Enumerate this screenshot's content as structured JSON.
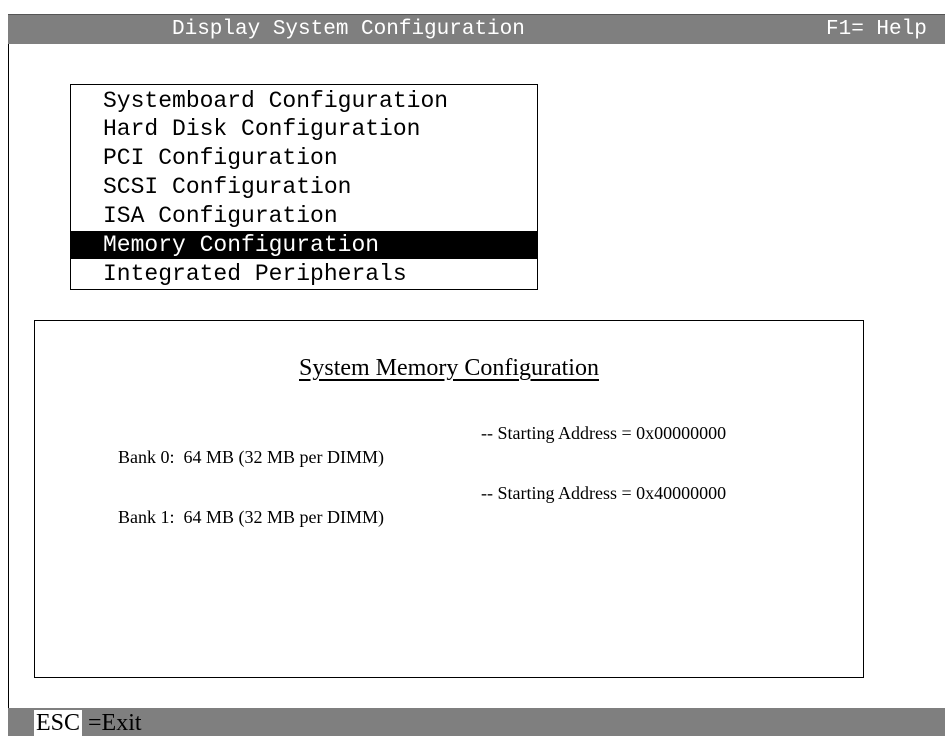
{
  "window": {
    "title": "Display System Configuration",
    "help": "F1= Help"
  },
  "menu": {
    "items": [
      {
        "label": "Systemboard Configuration",
        "selected": false
      },
      {
        "label": "Hard Disk Configuration",
        "selected": false
      },
      {
        "label": "PCI Configuration",
        "selected": false
      },
      {
        "label": "SCSI Configuration",
        "selected": false
      },
      {
        "label": "ISA Configuration",
        "selected": false
      },
      {
        "label": "Memory Configuration",
        "selected": true
      },
      {
        "label": "Integrated Peripherals",
        "selected": false
      }
    ]
  },
  "panel": {
    "title": "System Memory Configuration",
    "banks": [
      {
        "label": "Bank 0:  64 MB (32 MB per DIMM)",
        "address": "-- Starting Address = 0x00000000"
      },
      {
        "label": "Bank 1:  64 MB (32 MB per DIMM)",
        "address": "-- Starting Address = 0x40000000"
      }
    ]
  },
  "statusbar": {
    "key": "ESC",
    "action": "=Exit"
  },
  "colors": {
    "bar_gray": "#7f7f7f",
    "selected_bg": "#000000",
    "selected_fg": "#ffffff"
  }
}
